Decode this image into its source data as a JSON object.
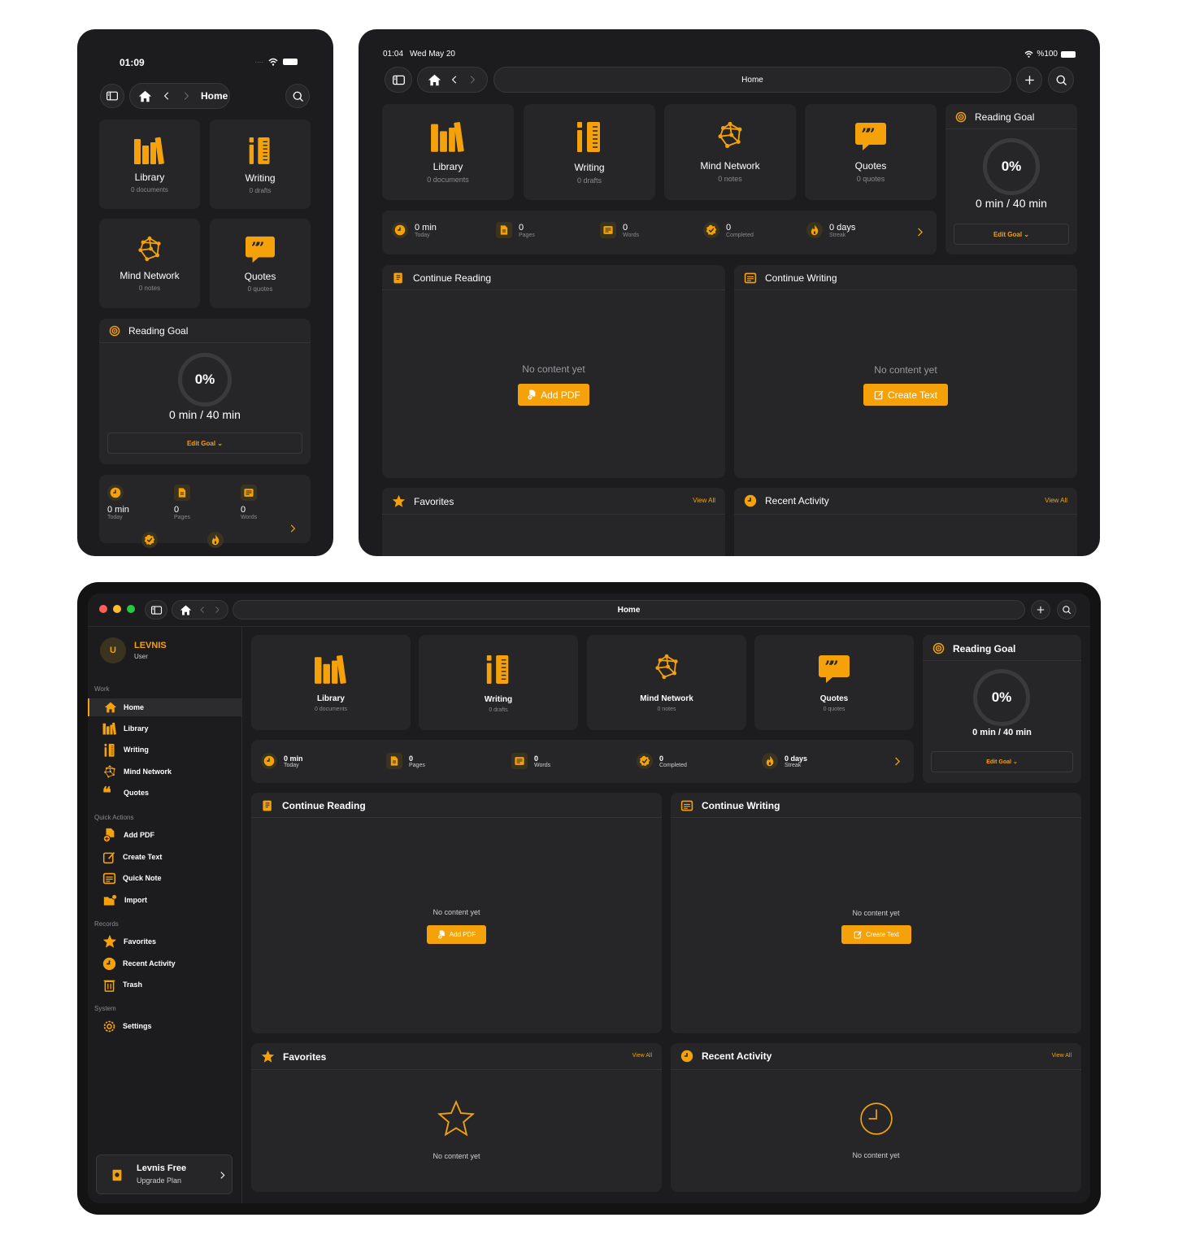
{
  "phone": {
    "time": "01:09",
    "nav": {
      "title": "Home"
    },
    "tiles": [
      {
        "icon": "library-icon",
        "title": "Library",
        "sub": "0 documents"
      },
      {
        "icon": "writing-icon",
        "title": "Writing",
        "sub": "0 drafts"
      },
      {
        "icon": "mind-network-icon",
        "title": "Mind Network",
        "sub": "0 notes"
      },
      {
        "icon": "quotes-icon",
        "title": "Quotes",
        "sub": "0 quotes"
      }
    ],
    "goal": {
      "title": "Reading Goal",
      "percent": "0%",
      "progress": "0 min / 40 min",
      "edit": "Edit Goal ⌄"
    },
    "stats": [
      {
        "icon": "clock-icon",
        "value": "0 min",
        "label": "Today"
      },
      {
        "icon": "pages-icon",
        "value": "0",
        "label": "Pages"
      },
      {
        "icon": "words-icon",
        "value": "0",
        "label": "Words"
      }
    ]
  },
  "tablet": {
    "time": "01:04",
    "date": "Wed May 20",
    "battery": "%100",
    "nav": {
      "title": "Home"
    },
    "tiles": [
      {
        "icon": "library-icon",
        "title": "Library",
        "sub": "0 documents"
      },
      {
        "icon": "writing-icon",
        "title": "Writing",
        "sub": "0 drafts"
      },
      {
        "icon": "mind-network-icon",
        "title": "Mind Network",
        "sub": "0 notes"
      },
      {
        "icon": "quotes-icon",
        "title": "Quotes",
        "sub": "0 quotes"
      }
    ],
    "goal": {
      "title": "Reading Goal",
      "percent": "0%",
      "progress": "0 min / 40 min",
      "edit": "Edit Goal ⌄"
    },
    "stats": [
      {
        "icon": "clock-icon",
        "value": "0 min",
        "label": "Today"
      },
      {
        "icon": "pages-icon",
        "value": "0",
        "label": "Pages"
      },
      {
        "icon": "words-icon",
        "value": "0",
        "label": "Words"
      },
      {
        "icon": "completed-icon",
        "value": "0",
        "label": "Completed"
      },
      {
        "icon": "flame-icon",
        "value": "0 days",
        "label": "Streak"
      }
    ],
    "continue_reading": {
      "title": "Continue Reading",
      "empty": "No content yet",
      "button": "Add PDF"
    },
    "continue_writing": {
      "title": "Continue Writing",
      "empty": "No content yet",
      "button": "Create Text"
    },
    "favorites": {
      "title": "Favorites",
      "view_all": "View All"
    },
    "recent": {
      "title": "Recent Activity",
      "view_all": "View All"
    }
  },
  "desktop": {
    "nav": {
      "title": "Home"
    },
    "user": {
      "initial": "U",
      "name": "LEVNIS",
      "role": "User"
    },
    "sidebar": {
      "sections": [
        {
          "title": "Work",
          "items": [
            {
              "icon": "home-icon",
              "label": "Home",
              "active": true
            },
            {
              "icon": "library-icon",
              "label": "Library"
            },
            {
              "icon": "writing-icon",
              "label": "Writing"
            },
            {
              "icon": "mind-network-icon",
              "label": "Mind Network"
            },
            {
              "icon": "quotes-icon",
              "label": "Quotes"
            }
          ]
        },
        {
          "title": "Quick Actions",
          "items": [
            {
              "icon": "add-pdf-icon",
              "label": "Add PDF"
            },
            {
              "icon": "create-text-icon",
              "label": "Create Text"
            },
            {
              "icon": "quick-note-icon",
              "label": "Quick Note"
            },
            {
              "icon": "import-icon",
              "label": "Import"
            }
          ]
        },
        {
          "title": "Records",
          "items": [
            {
              "icon": "star-icon",
              "label": "Favorites"
            },
            {
              "icon": "clock-icon",
              "label": "Recent Activity"
            },
            {
              "icon": "trash-icon",
              "label": "Trash"
            }
          ]
        },
        {
          "title": "System",
          "items": [
            {
              "icon": "gear-icon",
              "label": "Settings"
            }
          ]
        }
      ],
      "plan": {
        "title": "Levnis Free",
        "sub": "Upgrade Plan"
      }
    },
    "tiles": [
      {
        "icon": "library-icon",
        "title": "Library",
        "sub": "0 documents"
      },
      {
        "icon": "writing-icon",
        "title": "Writing",
        "sub": "0 drafts"
      },
      {
        "icon": "mind-network-icon",
        "title": "Mind Network",
        "sub": "0 notes"
      },
      {
        "icon": "quotes-icon",
        "title": "Quotes",
        "sub": "0 quotes"
      }
    ],
    "goal": {
      "title": "Reading Goal",
      "percent": "0%",
      "progress": "0 min / 40 min",
      "edit": "Edit Goal ⌄"
    },
    "stats": [
      {
        "icon": "clock-icon",
        "value": "0 min",
        "label": "Today"
      },
      {
        "icon": "pages-icon",
        "value": "0",
        "label": "Pages"
      },
      {
        "icon": "words-icon",
        "value": "0",
        "label": "Words"
      },
      {
        "icon": "completed-icon",
        "value": "0",
        "label": "Completed"
      },
      {
        "icon": "flame-icon",
        "value": "0 days",
        "label": "Streak"
      }
    ],
    "continue_reading": {
      "title": "Continue Reading",
      "empty": "No content yet",
      "button": "Add PDF"
    },
    "continue_writing": {
      "title": "Continue Writing",
      "empty": "No content yet",
      "button": "Create Text"
    },
    "favorites": {
      "title": "Favorites",
      "view_all": "View All",
      "empty": "No content yet"
    },
    "recent": {
      "title": "Recent Activity",
      "view_all": "View All",
      "empty": "No content yet"
    }
  },
  "colors": {
    "accent": "#f5a20a",
    "background": "#1c1c1e",
    "card": "#262628"
  }
}
